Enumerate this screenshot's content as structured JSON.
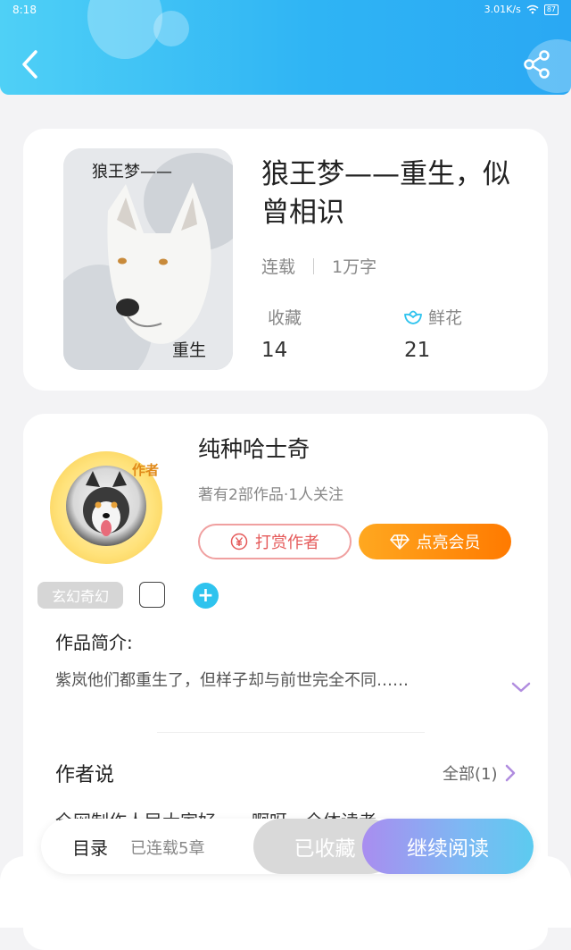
{
  "status_bar": {
    "time": "8:18",
    "network_speed": "3.01K/s",
    "battery": "87"
  },
  "header": {
    "back_icon": "chevron-left-icon",
    "share_icon": "share-icon"
  },
  "book": {
    "cover_text_top": "狼王梦——",
    "cover_text_bottom": "重生",
    "title": "狼王梦——重生，似曾相识",
    "status": "连载",
    "word_count": "1万字",
    "favorites_label": "收藏",
    "favorites_count": "14",
    "flowers_label": "鲜花",
    "flowers_count": "21"
  },
  "author": {
    "avatar_tag": "作者",
    "name": "纯种哈士奇",
    "info": "著有2部作品·1人关注",
    "reward_button": "打赏作者",
    "vip_button": "点亮会员",
    "genre_tag": "玄幻奇幻",
    "add_label": "+"
  },
  "intro": {
    "title": "作品简介:",
    "text": "紫岚他们都重生了，但样子却与前世完全不同……"
  },
  "author_says": {
    "title": "作者说",
    "all_label": "全部(1)",
    "preview": "全网制作人民大家好……啊呀，全体读者"
  },
  "bottom_bar": {
    "toc_label": "目录",
    "toc_count": "已连载5章",
    "collected_button": "已收藏",
    "continue_button": "继续阅读"
  },
  "colors": {
    "header_start": "#4fd0f6",
    "header_end": "#2aa8f3",
    "accent_orange": "#ff8a00",
    "accent_blue": "#2ec3ee"
  }
}
